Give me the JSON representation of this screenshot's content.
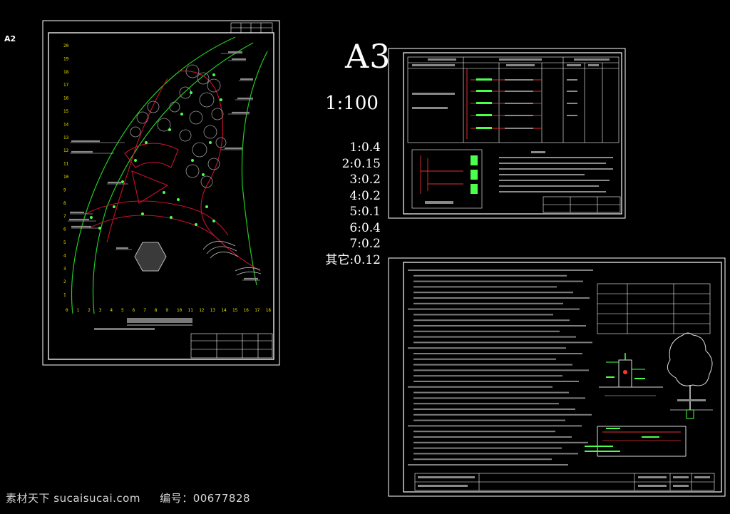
{
  "sheet_a2": {
    "label": "A2"
  },
  "sheet_a3": {
    "label": "A3",
    "main_scale": "1:100",
    "line_weights": [
      "1:0.4",
      "2:0.15",
      "3:0.2",
      "4:0.2",
      "5:0.1",
      "6:0.4",
      "7:0.2",
      "其它:0.12"
    ]
  },
  "plan_sheet": {
    "grid_numbers_bottom": [
      "0",
      "1",
      "2",
      "3",
      "4",
      "5",
      "6",
      "7",
      "8",
      "9",
      "10",
      "11",
      "12",
      "13",
      "14",
      "15",
      "16",
      "17",
      "18"
    ],
    "grid_numbers_left": [
      "20",
      "19",
      "18",
      "17",
      "16",
      "15",
      "14",
      "13",
      "12",
      "11",
      "10",
      "9",
      "8",
      "7",
      "6",
      "5",
      "4",
      "3",
      "2",
      "1"
    ]
  },
  "colors": {
    "background": "#000000",
    "frame": "#ffffff",
    "plan_red": "#c8102e",
    "plan_green": "#22cc22",
    "grid_yellow": "#e8e000",
    "light_green": "#4cff4c"
  },
  "watermark": {
    "site": "素材天下 sucaisucai.com",
    "code_label": "编号：00677828"
  }
}
